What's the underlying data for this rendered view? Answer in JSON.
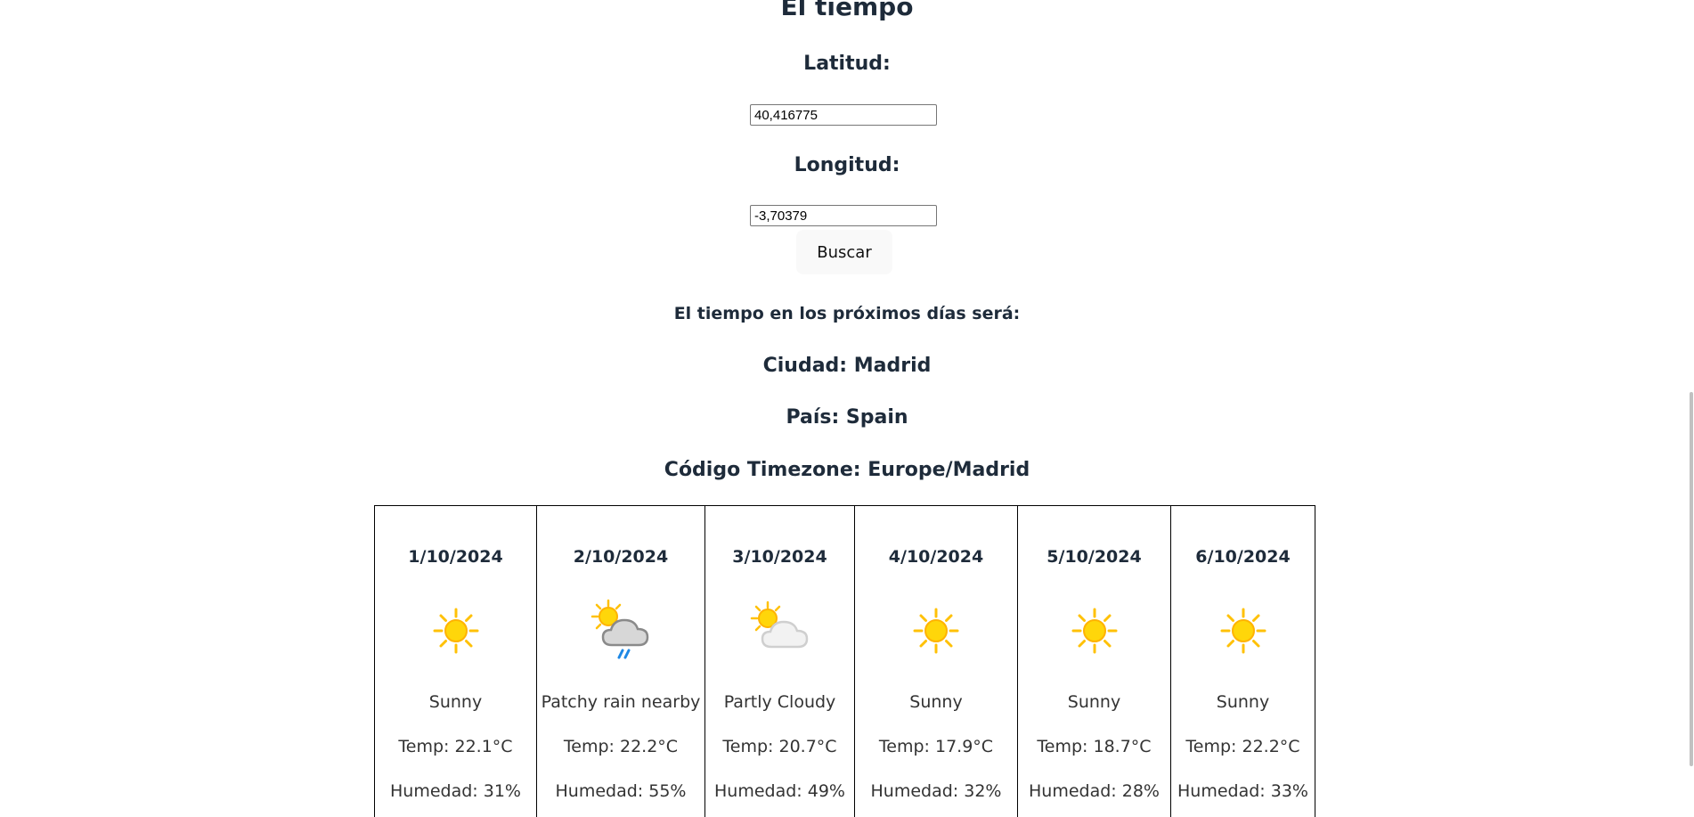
{
  "page": {
    "title": "El tiempo",
    "lat_label": "Latitud:",
    "lat_value": "40,416775",
    "lon_label": "Longitud:",
    "lon_value": "-3,70379",
    "search_button": "Buscar",
    "subtitle": "El tiempo en los próximos días será:",
    "city": "Ciudad: Madrid",
    "country": "País: Spain",
    "timezone": "Código Timezone: Europe/Madrid"
  },
  "forecast": [
    {
      "date": "1/10/2024",
      "icon": "sun-icon",
      "condition": "Sunny",
      "temp": "Temp: 22.1°C",
      "humidity": "Humedad: 31%"
    },
    {
      "date": "2/10/2024",
      "icon": "sun-rain-cloud-icon",
      "condition": "Patchy rain nearby",
      "temp": "Temp: 22.2°C",
      "humidity": "Humedad: 55%"
    },
    {
      "date": "3/10/2024",
      "icon": "sun-cloud-icon",
      "condition": "Partly Cloudy",
      "temp": "Temp: 20.7°C",
      "humidity": "Humedad: 49%"
    },
    {
      "date": "4/10/2024",
      "icon": "sun-icon",
      "condition": "Sunny",
      "temp": "Temp: 17.9°C",
      "humidity": "Humedad: 32%"
    },
    {
      "date": "5/10/2024",
      "icon": "sun-icon",
      "condition": "Sunny",
      "temp": "Temp: 18.7°C",
      "humidity": "Humedad: 28%"
    },
    {
      "date": "6/10/2024",
      "icon": "sun-icon",
      "condition": "Sunny",
      "temp": "Temp: 22.2°C",
      "humidity": "Humedad: 33%"
    }
  ],
  "colors": {
    "text": "#1e2b3a",
    "sun": "#ffc107",
    "sun_core": "#ffd60a",
    "cloud": "#e0e0e0",
    "rain": "#2196f3"
  }
}
